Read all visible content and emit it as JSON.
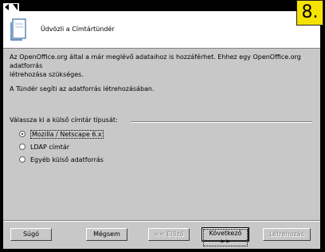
{
  "window": {
    "header_title": "Üdvözli a Címtártündér",
    "step_badge": "8."
  },
  "content": {
    "intro_line1": "Az OpenOffice.org által a már meglévő adataihoz is hozzáférhet. Ehhez egy OpenOffice.org adatforrás",
    "intro_line2": "létrehozása szükséges.",
    "intro_help": "A Tündér segíti az adatforrás létrehozásában.",
    "section_label": "Válassza ki a külső címtár típusát:",
    "options": [
      {
        "label": "Mozilla / Netscape 6.x",
        "selected": true
      },
      {
        "label": "LDAP címtár",
        "selected": false
      },
      {
        "label": "Egyéb külső adatforrás",
        "selected": false
      }
    ]
  },
  "buttons": {
    "help": "Súgó",
    "cancel": "Mégsem",
    "back": "<< Előző",
    "next": "Következő >>",
    "finish": "Létrehozás"
  }
}
